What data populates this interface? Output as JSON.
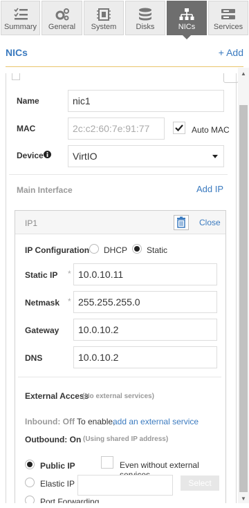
{
  "tabs": [
    {
      "label": "Summary",
      "icon": "summary-list-icon",
      "active": false
    },
    {
      "label": "General",
      "icon": "gears-icon",
      "active": false
    },
    {
      "label": "System",
      "icon": "chip-icon",
      "active": false
    },
    {
      "label": "Disks",
      "icon": "database-icon",
      "active": false
    },
    {
      "label": "NICs",
      "icon": "network-icon",
      "active": true
    },
    {
      "label": "Services",
      "icon": "services-icon",
      "active": false
    }
  ],
  "header": {
    "title": "NICs",
    "add_label": "+ Add"
  },
  "nic": {
    "name_label": "Name",
    "name_value": "nic1",
    "mac_label": "MAC",
    "mac_value": "2c:c2:60:7e:91:77",
    "auto_mac_label": "Auto MAC",
    "auto_mac_checked": true,
    "device_label": "Device",
    "device_value": "VirtIO",
    "main_interface_label": "Main Interface",
    "add_ip_label": "Add IP"
  },
  "ip": {
    "title": "IP1",
    "close_label": "Close",
    "config_label": "IP Configuration",
    "dhcp_label": "DHCP",
    "static_label": "Static",
    "static_ip_label": "Static IP",
    "static_ip_value": "10.0.10.11",
    "netmask_label": "Netmask",
    "netmask_value": "255.255.255.0",
    "gateway_label": "Gateway",
    "gateway_value": "10.0.10.2",
    "dns_label": "DNS",
    "dns_value": "10.0.10.2",
    "required_mark": "*",
    "external_access_label": "External Access",
    "external_access_note": "(No external services)",
    "inbound_label": "Inbound: Off",
    "inbound_text": "To enable,",
    "inbound_link": "add an external service",
    "outbound_label": "Outbound: On",
    "outbound_note": "(Using shared IP address)",
    "public_ip_label": "Public IP",
    "even_without_label": "Even without external services",
    "elastic_ip_label": "Elastic IP",
    "select_label": "Select",
    "port_forwarding_label": "Port Forwarding"
  },
  "colors": {
    "accent": "#3a7abf",
    "active_tab": "#6e6e6e",
    "header_rule": "#e9c46a"
  }
}
